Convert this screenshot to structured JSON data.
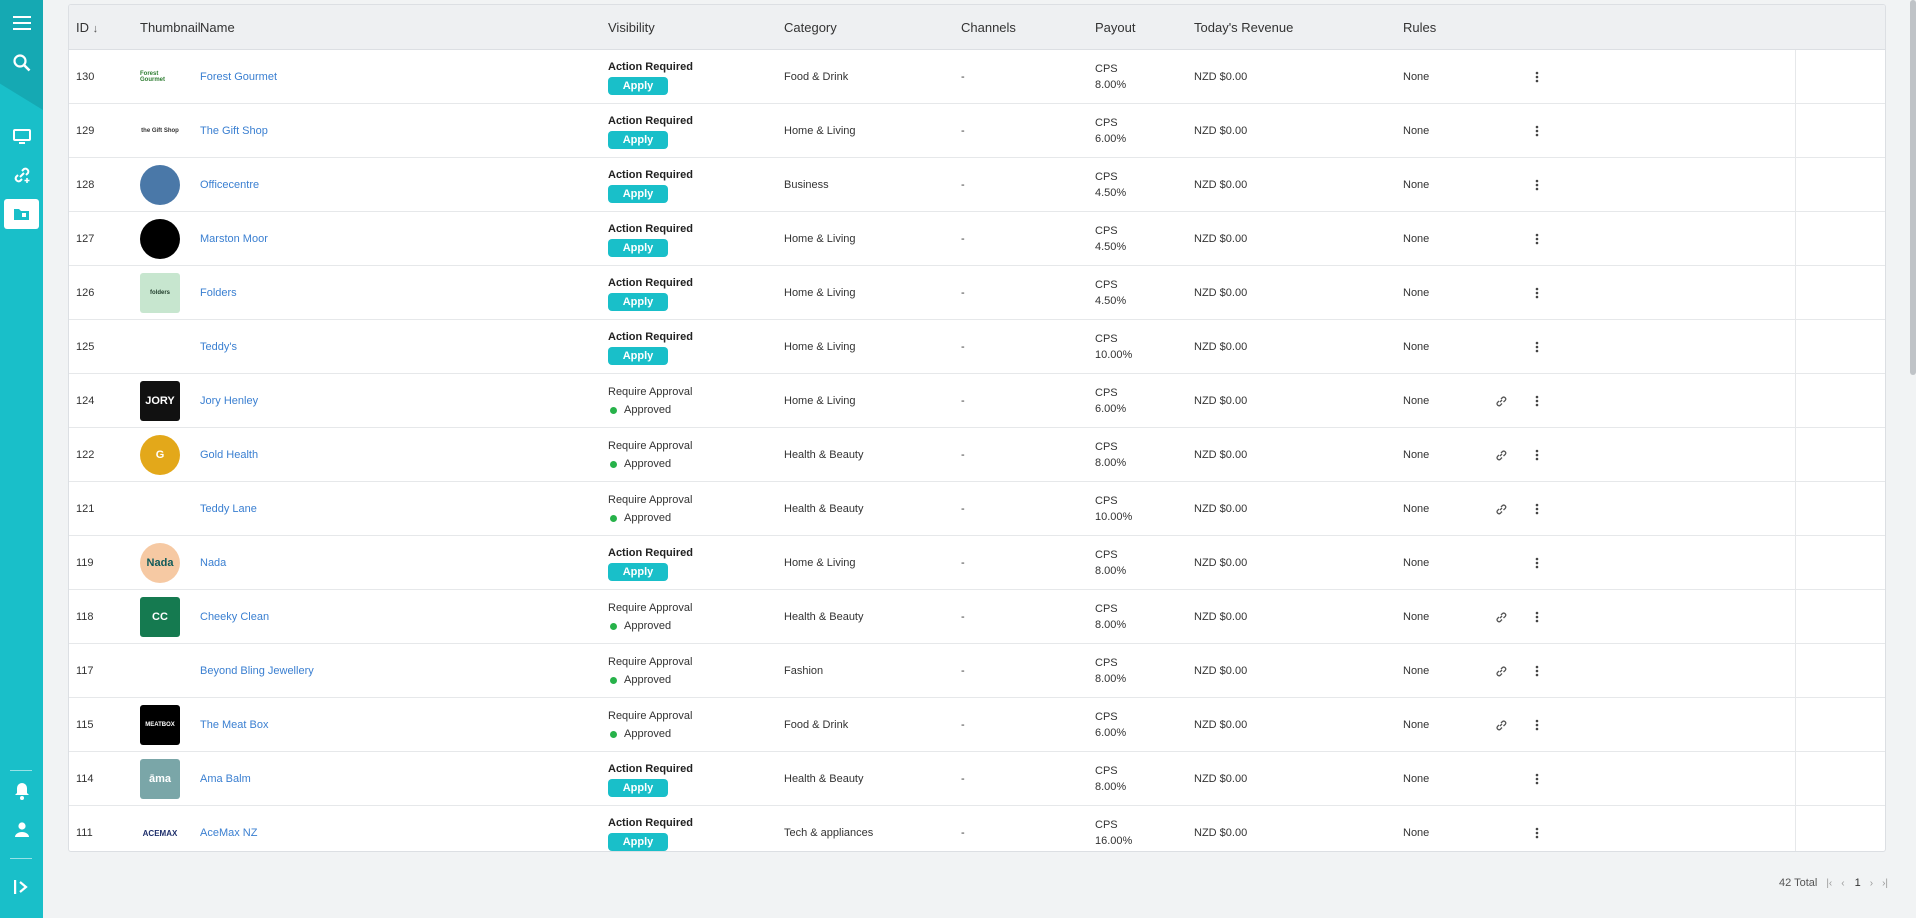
{
  "header": {
    "id": "ID",
    "thumbnail": "Thumbnail",
    "name": "Name",
    "visibility": "Visibility",
    "category": "Category",
    "channels": "Channels",
    "payout": "Payout",
    "revenue": "Today's Revenue",
    "rules": "Rules"
  },
  "sidebar": {
    "top": [
      "menu-icon",
      "search-icon"
    ],
    "mid": [
      "monitor-icon",
      "link-add-icon",
      "folder-icon"
    ],
    "bottom": [
      "bell-icon",
      "user-icon",
      "expand-icon"
    ]
  },
  "rows": [
    {
      "id": "130",
      "name": "Forest Gourmet",
      "vis1": "Action Required",
      "vis2": "Apply",
      "status": "action",
      "category": "Food & Drink",
      "channels": "-",
      "payout_type": "CPS",
      "payout_rate": "8.00%",
      "revenue": "NZD $0.00",
      "rules": "None",
      "link": false,
      "thumb": {
        "text": "Forest Gourmet",
        "bg": "#ffffff",
        "fg": "#2e7d32"
      }
    },
    {
      "id": "129",
      "name": "The Gift Shop",
      "vis1": "Action Required",
      "vis2": "Apply",
      "status": "action",
      "category": "Home & Living",
      "channels": "-",
      "payout_type": "CPS",
      "payout_rate": "6.00%",
      "revenue": "NZD $0.00",
      "rules": "None",
      "link": false,
      "thumb": {
        "text": "the Gift Shop",
        "bg": "#ffffff",
        "fg": "#333333"
      }
    },
    {
      "id": "128",
      "name": "Officecentre",
      "vis1": "Action Required",
      "vis2": "Apply",
      "status": "action",
      "category": "Business",
      "channels": "-",
      "payout_type": "CPS",
      "payout_rate": "4.50%",
      "revenue": "NZD $0.00",
      "rules": "None",
      "link": false,
      "thumb": {
        "text": "",
        "bg": "#4a78a8",
        "fg": "#ffffff"
      }
    },
    {
      "id": "127",
      "name": "Marston Moor",
      "vis1": "Action Required",
      "vis2": "Apply",
      "status": "action",
      "category": "Home & Living",
      "channels": "-",
      "payout_type": "CPS",
      "payout_rate": "4.50%",
      "revenue": "NZD $0.00",
      "rules": "None",
      "link": false,
      "thumb": {
        "text": "",
        "bg": "#000000",
        "fg": "#ffffff"
      }
    },
    {
      "id": "126",
      "name": "Folders",
      "vis1": "Action Required",
      "vis2": "Apply",
      "status": "action",
      "category": "Home & Living",
      "channels": "-",
      "payout_type": "CPS",
      "payout_rate": "4.50%",
      "revenue": "NZD $0.00",
      "rules": "None",
      "link": false,
      "thumb": {
        "text": "folders",
        "bg": "#c7e6cf",
        "fg": "#1f3b2a"
      }
    },
    {
      "id": "125",
      "name": "Teddy's",
      "vis1": "Action Required",
      "vis2": "Apply",
      "status": "action",
      "category": "Home & Living",
      "channels": "-",
      "payout_type": "CPS",
      "payout_rate": "10.00%",
      "revenue": "NZD $0.00",
      "rules": "None",
      "link": false,
      "thumb": {
        "text": "",
        "bg": "#ffffff",
        "fg": "#e8a13a"
      }
    },
    {
      "id": "124",
      "name": "Jory Henley",
      "vis1": "Require Approval",
      "vis2": "Approved",
      "status": "approved",
      "category": "Home & Living",
      "channels": "-",
      "payout_type": "CPS",
      "payout_rate": "6.00%",
      "revenue": "NZD $0.00",
      "rules": "None",
      "link": true,
      "thumb": {
        "text": "JORY",
        "bg": "#111111",
        "fg": "#ffffff"
      }
    },
    {
      "id": "122",
      "name": "Gold Health",
      "vis1": "Require Approval",
      "vis2": "Approved",
      "status": "approved",
      "category": "Health & Beauty",
      "channels": "-",
      "payout_type": "CPS",
      "payout_rate": "8.00%",
      "revenue": "NZD $0.00",
      "rules": "None",
      "link": true,
      "thumb": {
        "text": "G",
        "bg": "#e3a81a",
        "fg": "#ffffff"
      }
    },
    {
      "id": "121",
      "name": "Teddy Lane",
      "vis1": "Require Approval",
      "vis2": "Approved",
      "status": "approved",
      "category": "Health & Beauty",
      "channels": "-",
      "payout_type": "CPS",
      "payout_rate": "10.00%",
      "revenue": "NZD $0.00",
      "rules": "None",
      "link": true,
      "thumb": {
        "text": "",
        "bg": "#ffffff",
        "fg": "#999999"
      }
    },
    {
      "id": "119",
      "name": "Nada",
      "vis1": "Action Required",
      "vis2": "Apply",
      "status": "action",
      "category": "Home & Living",
      "channels": "-",
      "payout_type": "CPS",
      "payout_rate": "8.00%",
      "revenue": "NZD $0.00",
      "rules": "None",
      "link": false,
      "thumb": {
        "text": "Nada",
        "bg": "#f6c9a3",
        "fg": "#0f5a5a"
      }
    },
    {
      "id": "118",
      "name": "Cheeky Clean",
      "vis1": "Require Approval",
      "vis2": "Approved",
      "status": "approved",
      "category": "Health & Beauty",
      "channels": "-",
      "payout_type": "CPS",
      "payout_rate": "8.00%",
      "revenue": "NZD $0.00",
      "rules": "None",
      "link": true,
      "thumb": {
        "text": "CC",
        "bg": "#157a50",
        "fg": "#ffffff"
      }
    },
    {
      "id": "117",
      "name": "Beyond Bling Jewellery",
      "vis1": "Require Approval",
      "vis2": "Approved",
      "status": "approved",
      "category": "Fashion",
      "channels": "-",
      "payout_type": "CPS",
      "payout_rate": "8.00%",
      "revenue": "NZD $0.00",
      "rules": "None",
      "link": true,
      "thumb": {
        "text": "",
        "bg": "#ffffff",
        "fg": "#666666"
      }
    },
    {
      "id": "115",
      "name": "The Meat Box",
      "vis1": "Require Approval",
      "vis2": "Approved",
      "status": "approved",
      "category": "Food & Drink",
      "channels": "-",
      "payout_type": "CPS",
      "payout_rate": "6.00%",
      "revenue": "NZD $0.00",
      "rules": "None",
      "link": true,
      "thumb": {
        "text": "MEATBOX",
        "bg": "#000000",
        "fg": "#ffffff"
      }
    },
    {
      "id": "114",
      "name": "Ama Balm",
      "vis1": "Action Required",
      "vis2": "Apply",
      "status": "action",
      "category": "Health & Beauty",
      "channels": "-",
      "payout_type": "CPS",
      "payout_rate": "8.00%",
      "revenue": "NZD $0.00",
      "rules": "None",
      "link": false,
      "thumb": {
        "text": "āma",
        "bg": "#7aa6a8",
        "fg": "#ffffff"
      }
    },
    {
      "id": "111",
      "name": "AceMax NZ",
      "vis1": "Action Required",
      "vis2": "Apply",
      "status": "action",
      "category": "Tech & appliances",
      "channels": "-",
      "payout_type": "CPS",
      "payout_rate": "16.00%",
      "revenue": "NZD $0.00",
      "rules": "None",
      "link": false,
      "thumb": {
        "text": "ACEMAX",
        "bg": "#ffffff",
        "fg": "#1e2f6b"
      }
    }
  ],
  "footer": {
    "total": "42 Total",
    "page": "1"
  }
}
